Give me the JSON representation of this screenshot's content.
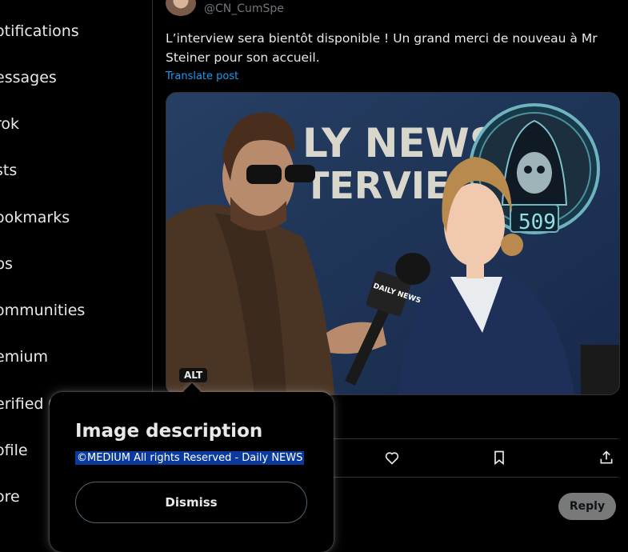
{
  "sidebar": {
    "items": [
      {
        "label": "otifications"
      },
      {
        "label": "essages"
      },
      {
        "label": "rok"
      },
      {
        "label": "sts"
      },
      {
        "label": "ookmarks"
      },
      {
        "label": "bs"
      },
      {
        "label": "ommunities"
      },
      {
        "label": "emium"
      },
      {
        "label": "erified O"
      },
      {
        "label": "ofile"
      },
      {
        "label": "ore"
      }
    ]
  },
  "post": {
    "handle": "@CN_CumSpe",
    "text": "L’interview sera bientôt disponible ! Un grand merci de nouveau à Mr Steiner pour son accueil.",
    "translate_label": "Translate post",
    "image": {
      "headline_line1": "LY NEWS",
      "headline_line2": "TERVIE",
      "mic_label": "DAILY NEWS",
      "emblem_number": "509",
      "alt_badge": "ALT"
    }
  },
  "actions": {
    "icons": [
      "heart-icon",
      "bookmark-icon",
      "share-icon"
    ]
  },
  "reply_label": "Reply",
  "alt_popup": {
    "title": "Image description",
    "description": "©MEDIUM All rights Reserved - Daily NEWS",
    "dismiss_label": "Dismiss"
  },
  "colors": {
    "background": "#000000",
    "accent": "#1d9bf0",
    "selection": "#0a3a9e",
    "reply_button": "#787a7a"
  }
}
